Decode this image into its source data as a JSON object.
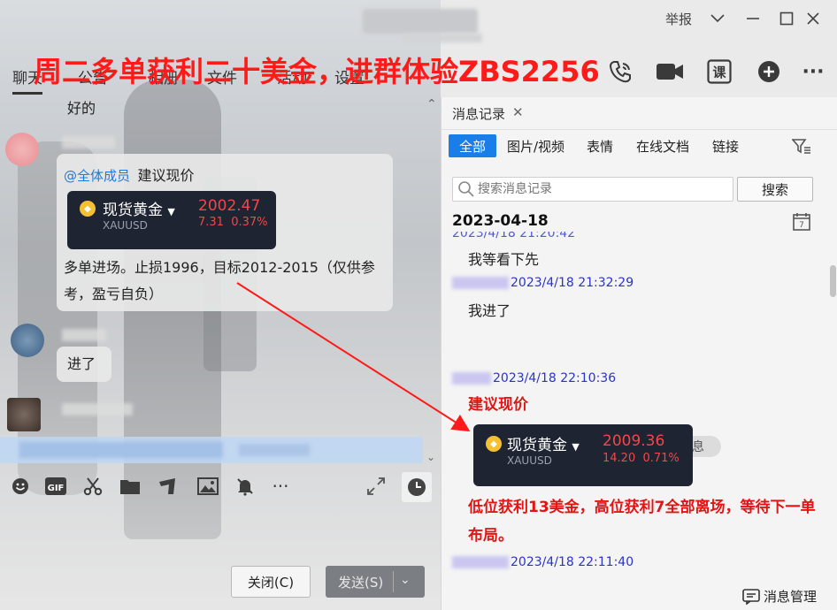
{
  "window": {
    "report_label": "举报",
    "promo_text": "周二多单获利二十美金，进群体验ZBS2256"
  },
  "tabs": [
    "聊天",
    "公告",
    "相册",
    "文件",
    "活动",
    "设置"
  ],
  "chat": {
    "top_partial": "好的",
    "mention": "@全体成员",
    "suggest": "建议现价",
    "card": {
      "name": "现货黄金",
      "symbol": "XAUUSD",
      "price": "2002.47",
      "change": "7.31",
      "pct": "0.37%"
    },
    "trade_note": "多单进场。止损1996，目标2012-2015（仅供参考，盈亏自负）",
    "joined": "进了"
  },
  "buttons": {
    "close": "关闭(C)",
    "send": "发送(S)"
  },
  "history": {
    "tab_label": "消息记录",
    "filters": [
      "全部",
      "图片/视频",
      "表情",
      "在线文档",
      "链接"
    ],
    "search_placeholder": "搜索消息记录",
    "search_button": "搜索",
    "date": "2023-04-18",
    "cut_time": "2023/4/18 21:20:42",
    "msg1": "我等看下先",
    "time2": "2023/4/18 21:32:29",
    "msg2": "我进了",
    "recall": "李老师撤回了一条消息",
    "time3": "2023/4/18 22:10:36",
    "suggest": "建议现价",
    "card": {
      "name": "现货黄金",
      "symbol": "XAUUSD",
      "price": "2009.36",
      "change": "14.20",
      "pct": "0.71%"
    },
    "result": "低位获利13美金，高位获利7全部离场，等待下一单布局。",
    "time4": "2023/4/18 22:11:40",
    "footer": "消息管理"
  },
  "colors": {
    "accent": "#1a7ee8",
    "promo": "#ff1a1a",
    "price": "#f04848",
    "meta": "#2a34c7"
  }
}
